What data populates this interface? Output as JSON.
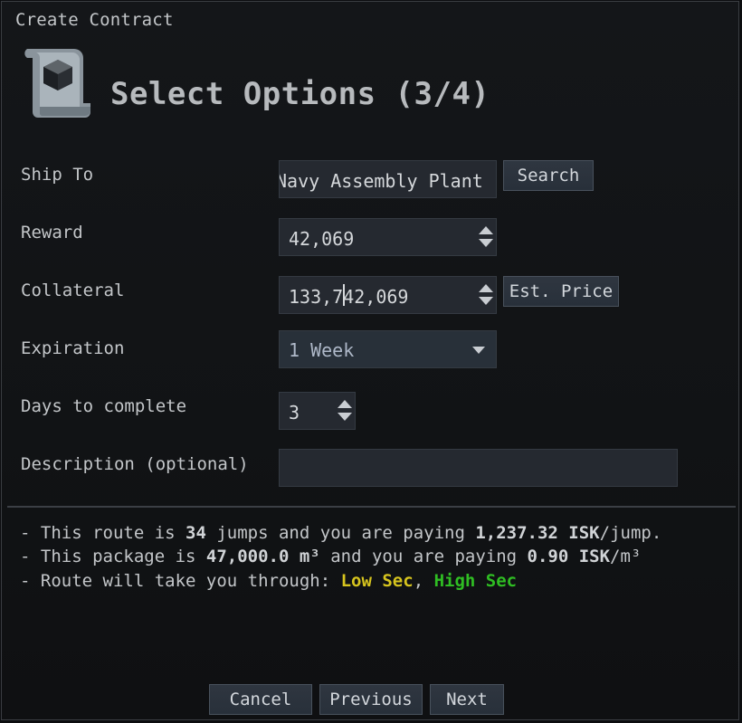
{
  "window": {
    "title": "Create Contract"
  },
  "header": {
    "title": "Select Options (3/4)",
    "icon": "contract-scroll-cube-icon"
  },
  "form": {
    "ship_to": {
      "label": "Ship To",
      "value": "Navy Assembly Plant",
      "button": "Search"
    },
    "reward": {
      "label": "Reward",
      "value": "42,069"
    },
    "collateral": {
      "label": "Collateral",
      "value": "133,742,069",
      "button": "Est. Price"
    },
    "expiration": {
      "label": "Expiration",
      "value": "1 Week"
    },
    "days": {
      "label": "Days to complete",
      "value": "3"
    },
    "description": {
      "label": "Description (optional)",
      "value": ""
    }
  },
  "info": {
    "route": {
      "prefix": "- This route is ",
      "jumps": "34",
      "mid": " jumps and you are paying ",
      "amount": "1,237.32 ISK",
      "suffix": "/jump."
    },
    "package": {
      "prefix": "- This package is ",
      "volume": "47,000.0 m³",
      "mid": " and you are paying ",
      "amount": "0.90 ISK",
      "suffix": "/m³"
    },
    "through": {
      "prefix": "- Route will take you through: ",
      "low": "Low Sec",
      "sep": ", ",
      "high": "High Sec"
    }
  },
  "colors": {
    "low_sec": "#d6c41e",
    "high_sec": "#2fbd23"
  },
  "footer": {
    "cancel": "Cancel",
    "previous": "Previous",
    "next": "Next"
  }
}
